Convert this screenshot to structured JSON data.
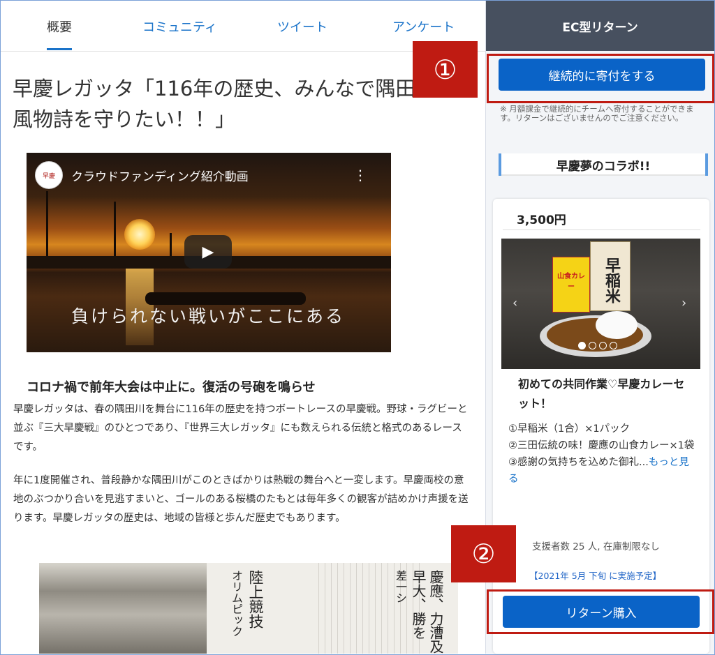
{
  "tabs": {
    "overview": "概要",
    "community": "コミュニティ",
    "tweet": "ツイート",
    "survey": "アンケート"
  },
  "project": {
    "title": "早慶レガッタ「116年の歴史、みんなで隅田川の風物詩を守りたい！！」"
  },
  "video": {
    "logo_text": "早慶",
    "title": "クラウドファンディング紹介動画",
    "menu_glyph": "⋮",
    "play_glyph": "▶",
    "caption": "負けられない戦いがここにある"
  },
  "body": {
    "subheading": "コロナ禍で前年大会は中止に。復活の号砲を鳴らせ",
    "para1": "早慶レガッタは、春の隅田川を舞台に116年の歴史を持つボートレースの早慶戦。野球・ラグビーと並ぶ『三大早慶戦』のひとつであり、『世界三大レガッタ』にも数えられる伝統と格式のあるレースです。",
    "para2": "年に1度開催され、普段静かな隅田川がこのときばかりは熱戦の舞台へと一変します。早慶両校の意地のぶつかり合いを見逃すまいと、ゴールのある桜橋のたもとは毎年多くの観客が詰めかけ声援を送ります。早慶レガッタの歴史は、地域の皆様と歩んだ歴史でもあります。",
    "news": {
      "col1": "オリムピック",
      "col2": "陸上競技",
      "col3": "慶應、力漕及",
      "col4": "早大、勝を",
      "col5": "差一シ"
    }
  },
  "sidebar": {
    "header": "EC型リターン",
    "donate_button": "継続的に寄付をする",
    "donate_note": "※ 月額課金で継続的にチームへ寄付することができます。リターンはございませんのでご注意ください。",
    "collab_label": "早慶夢のコラボ!!",
    "reward": {
      "price": "3,500円",
      "title": "初めての共同作業♡早慶カレーセット！",
      "items": [
        "①早稲米（1合）×1パック",
        "②三田伝統の味！慶應の山食カレー×1袋",
        "③感謝の気持ちを込めた御礼..."
      ],
      "more_link": "もっと見る",
      "supporters": "支援者数 25 人, 在庫制限なし",
      "schedule": "【2021年 5月 下旬 に実施予定】",
      "buy_button": "リターン購入",
      "box1_text": "山食カレー",
      "box2_text": "早稲米",
      "prev_glyph": "‹",
      "next_glyph": "›",
      "carousel_pages": 4,
      "carousel_current": 1
    }
  },
  "annotations": {
    "callout1": "①",
    "callout2": "②",
    "color": "#bf1b12"
  },
  "colors": {
    "accent": "#0a63c7",
    "link": "#1a73c9",
    "sidebar_header": "#47505f"
  }
}
